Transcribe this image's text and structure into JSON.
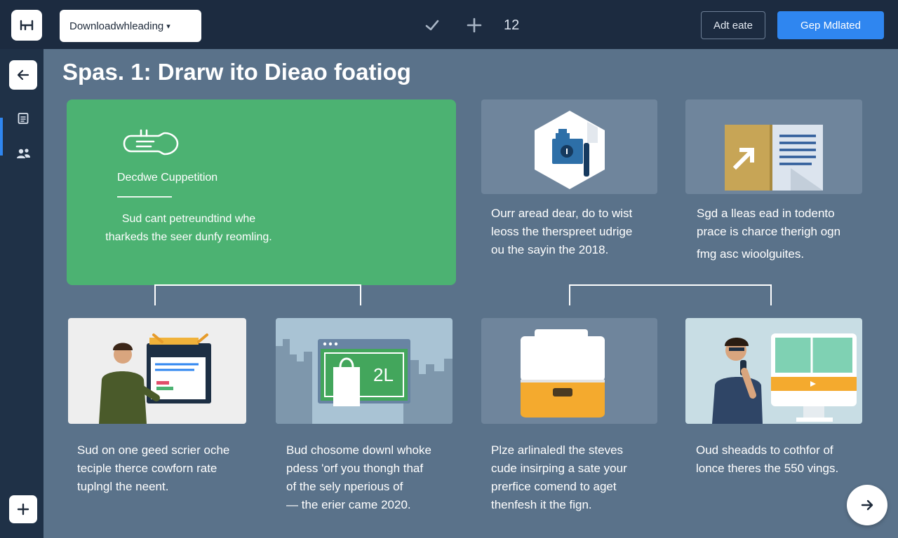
{
  "colors": {
    "topbar_bg": "#1c2b40",
    "content_bg": "#5a728a",
    "accent_green": "#4cb272",
    "primary_blue": "#2f86f0"
  },
  "header": {
    "dropdown_label": "Downloadwhleading",
    "toolbar_count": "12",
    "secondary_button": "Adt eate",
    "primary_button": "Gep Mdlated",
    "icons": [
      "logo-icon",
      "check-icon",
      "plus-icon"
    ]
  },
  "sidebar": {
    "icons": [
      "back-arrow-icon",
      "document-icon",
      "users-icon",
      "plus-icon"
    ]
  },
  "main": {
    "title": "Spas. 1: Drarw ito Dieao foatiog",
    "feature_card": {
      "label": "Decdwe Cuppetition",
      "description_lines": [
        "Sud cant petreundtind whe",
        "tharkeds the seer dunfy reomling."
      ]
    },
    "top_texts": [
      {
        "lines": [
          "Ourr aread dear, do to wist",
          "leoss the therspreet udrige",
          "ou the sayin the 2018."
        ]
      },
      {
        "lines": [
          "Sgd a lleas ead in todento",
          "prace is charce therigh ogn",
          "fmg asc wioolguites."
        ]
      }
    ],
    "tiles": [
      {
        "id": "person-screen"
      },
      {
        "id": "city-window",
        "badge": "2L"
      },
      {
        "id": "storage-box"
      },
      {
        "id": "person-phone"
      }
    ],
    "bottom_texts": [
      {
        "lines": [
          "Sud on one geed scrier oche",
          "teciple therce cowforn rate",
          "tuplngl the neent."
        ]
      },
      {
        "lines": [
          "Bud chosome downl whoke",
          "pdess 'orf you thongh thaf",
          "of the sely nperious of",
          "— the erier came 2020."
        ]
      },
      {
        "lines": [
          "Plze arlinaledl the steves",
          "cude insirping a sate your",
          "prerfice comend to aget",
          "thenfesh it the fign."
        ]
      },
      {
        "lines": [
          "Oud sheadds to cothfor of",
          "lonce theres the 550 vings."
        ]
      }
    ]
  }
}
